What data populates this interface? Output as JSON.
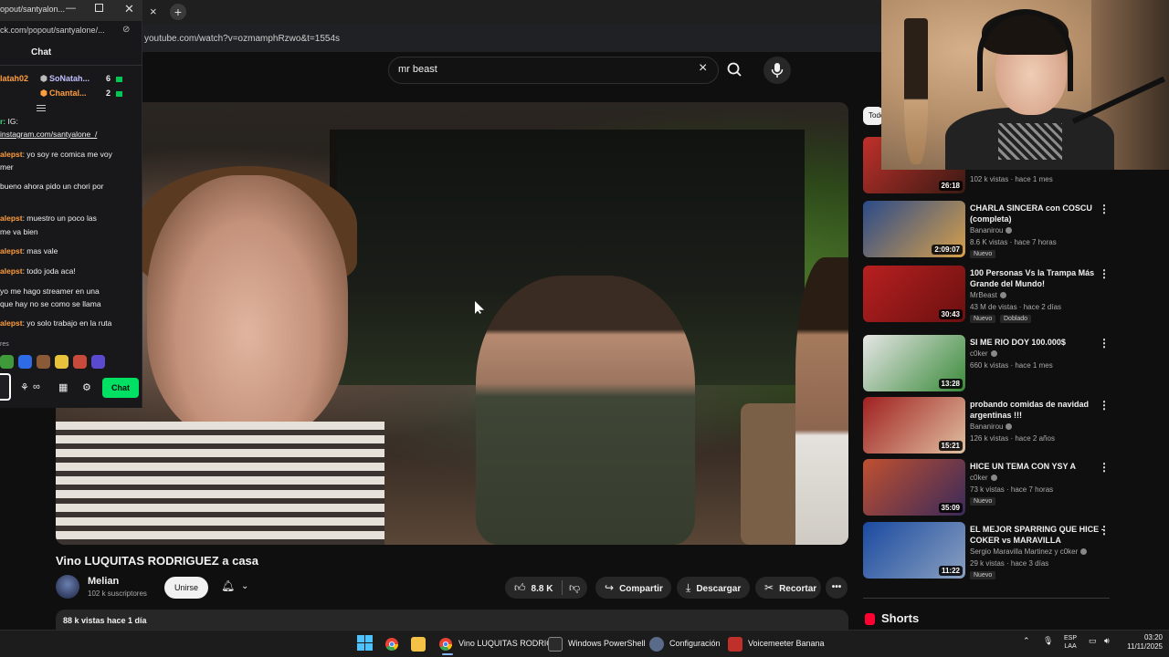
{
  "browser": {
    "url": "youtube.com/watch?v=ozmamphRzwo&t=1554s",
    "tab_close": "×",
    "new_tab": "+"
  },
  "search": {
    "query": "mr beast",
    "clear_icon": "×"
  },
  "video": {
    "title": "Vino LUQUITAS RODRIGUEZ a casa",
    "channel": "Melian",
    "subscribers": "102 k suscriptores",
    "join_label": "Unirse",
    "like_count": "8.8 K",
    "share_label": "Compartir",
    "download_label": "Descargar",
    "clip_label": "Recortar",
    "more_label": "•••",
    "views_date": "88 k vistas  hace 1 día"
  },
  "recommendations": {
    "chip_label": "Todo",
    "items": [
      {
        "title": "",
        "channel": "",
        "meta": "102 k vistas · hace 1 mes",
        "duration": "26:18",
        "badges": []
      },
      {
        "title": "CHARLA SINCERA con COSCU (completa)",
        "channel": "Bananirou",
        "meta": "8.6 K vistas · hace 7 horas",
        "duration": "2:09:07",
        "badges": [
          "Nuevo"
        ]
      },
      {
        "title": "100 Personas Vs la Trampa Más Grande del Mundo!",
        "channel": "MrBeast",
        "meta": "43 M de vistas · hace 2 días",
        "duration": "30:43",
        "badges": [
          "Nuevo",
          "Doblado"
        ]
      },
      {
        "title": "SI ME RIO DOY 100.000$",
        "channel": "c0ker",
        "meta": "660 k vistas · hace 1 mes",
        "duration": "13:28",
        "badges": []
      },
      {
        "title": "probando comidas de navidad argentinas !!!",
        "channel": "Bananirou",
        "meta": "126 k vistas · hace 2 años",
        "duration": "15:21",
        "badges": []
      },
      {
        "title": "HICE UN TEMA CON YSY A",
        "channel": "c0ker",
        "meta": "73 k vistas · hace 7 horas",
        "duration": "35:09",
        "badges": [
          "Nuevo"
        ]
      },
      {
        "title": "EL MEJOR SPARRING QUE HICE - COKER vs MARAVILLA",
        "channel": "Sergio Maravilla Martinez y c0ker",
        "meta": "29 k vistas · hace 3 días",
        "duration": "11:22",
        "badges": [
          "Nuevo"
        ]
      }
    ],
    "shorts_label": "Shorts"
  },
  "chat": {
    "window_title": "opout/santyalon...",
    "url": "ck.com/popout/santyalone/...",
    "header": "Chat",
    "gifters": [
      {
        "left": "latah02",
        "name": "SoNatah...",
        "count": "6"
      },
      {
        "left": "",
        "name": "Chantal...",
        "count": "2"
      }
    ],
    "messages": [
      {
        "user": "r:",
        "text": " IG:"
      },
      {
        "user": "",
        "text": "instagram.com/santyalone_/"
      },
      {
        "user": "alepst",
        "text": ": yo soy re comica me voy"
      },
      {
        "user": "",
        "text": "mer"
      },
      {
        "user": "",
        "text": "bueno ahora pido un chori por"
      },
      {
        "user": "alepst",
        "text": ": muestro un poco las"
      },
      {
        "user": "",
        "text": "me va bien"
      },
      {
        "user": "alepst",
        "text": ": mas vale"
      },
      {
        "user": "alepst",
        "text": ": todo joda aca!"
      },
      {
        "user": "",
        "text": "yo me hago streamer en una"
      },
      {
        "user": "",
        "text": "que hay no se como se llama"
      },
      {
        "user": "alepst",
        "text": ": yo solo trabajo en la ruta"
      }
    ],
    "emote_label": "res",
    "chat_button": "Chat"
  },
  "taskbar": {
    "items": [
      {
        "label": "Vino LUQUITAS RODRIG"
      },
      {
        "label": "Windows PowerShell"
      },
      {
        "label": "Configuración"
      },
      {
        "label": "Voicemeeter Banana"
      }
    ],
    "lang_top": "ESP",
    "lang_bottom": "LAA",
    "time": "03:20",
    "date": "11/11/2025"
  },
  "colors": {
    "youtube_bg": "#0f0f0f",
    "twitch_green": "#00e062",
    "twitch_bg": "#18181b",
    "chat_user_orange": "#ff9e3d",
    "chat_user_green": "#3fe07a"
  }
}
